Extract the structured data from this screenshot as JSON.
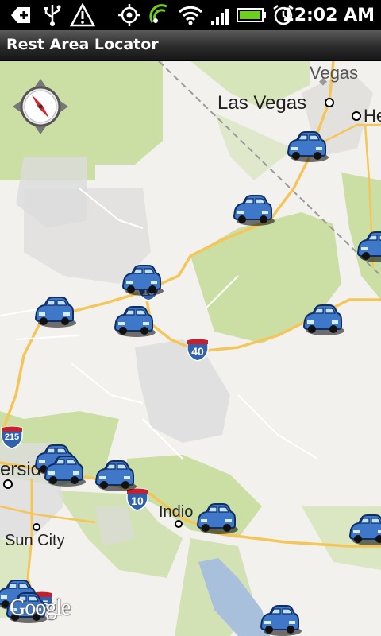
{
  "status_bar": {
    "time": "12:02 AM",
    "icons": [
      "notification-plus-icon",
      "usb-icon",
      "warning-icon",
      "gps-icon",
      "sync-icon",
      "wifi-icon",
      "signal-icon",
      "battery-icon",
      "alarm-icon"
    ],
    "battery_level": 1.0
  },
  "app": {
    "title": "Rest Area Locator"
  },
  "map": {
    "labels": {
      "vegas": "Vegas",
      "las_vegas": "Las Vegas",
      "henderson_partial": "He",
      "riverside_partial": "ersid",
      "indio": "Indio",
      "sun_city": "Sun City"
    },
    "shields": [
      "40",
      "15",
      "215",
      "10",
      "15"
    ],
    "markers": [
      {
        "name": "rest-area-marker-1"
      },
      {
        "name": "rest-area-marker-2"
      },
      {
        "name": "rest-area-marker-3"
      },
      {
        "name": "rest-area-marker-4"
      },
      {
        "name": "rest-area-marker-5"
      },
      {
        "name": "rest-area-marker-6"
      },
      {
        "name": "rest-area-marker-7"
      },
      {
        "name": "rest-area-marker-8"
      },
      {
        "name": "rest-area-marker-9"
      },
      {
        "name": "rest-area-marker-10"
      },
      {
        "name": "rest-area-marker-11"
      },
      {
        "name": "rest-area-marker-12"
      },
      {
        "name": "rest-area-marker-13"
      },
      {
        "name": "rest-area-marker-14"
      },
      {
        "name": "rest-area-marker-15"
      }
    ],
    "attribution": "Google",
    "colors": {
      "land": "#f3f1ee",
      "park": "#cbdfa5",
      "urban": "#dcdcdc",
      "highway": "#f4c65a",
      "water": "#a9c0dd",
      "interstate": "#2f61ad"
    }
  }
}
